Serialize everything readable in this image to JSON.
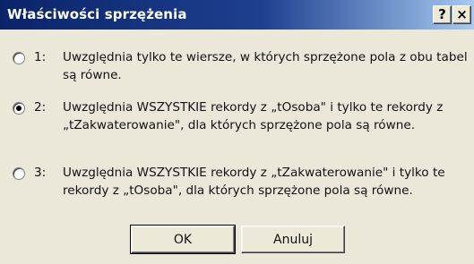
{
  "window": {
    "title": "Właściwości sprzężenia",
    "help_label": "?",
    "close_label": "×"
  },
  "options": [
    {
      "number": "1:",
      "text": "Uwzględnia tylko te wiersze, w których sprzężone pola z obu tabel są równe.",
      "selected": false
    },
    {
      "number": "2:",
      "text": "Uwzględnia WSZYSTKIE rekordy z „tOsoba\" i tylko te rekordy z „tZakwaterowanie\", dla których sprzężone pola są równe.",
      "selected": true
    },
    {
      "number": "3:",
      "text": "Uwzględnia WSZYSTKIE rekordy z „tZakwaterowanie\" i tylko te rekordy z „tOsoba\", dla których sprzężone pola są równe.",
      "selected": false
    }
  ],
  "buttons": {
    "ok_label": "OK",
    "cancel_label": "Anuluj"
  },
  "colors": {
    "title_bar_start": "#0a246a",
    "title_bar_end": "#a6caf0",
    "dialog_background": "#ebe8da"
  }
}
